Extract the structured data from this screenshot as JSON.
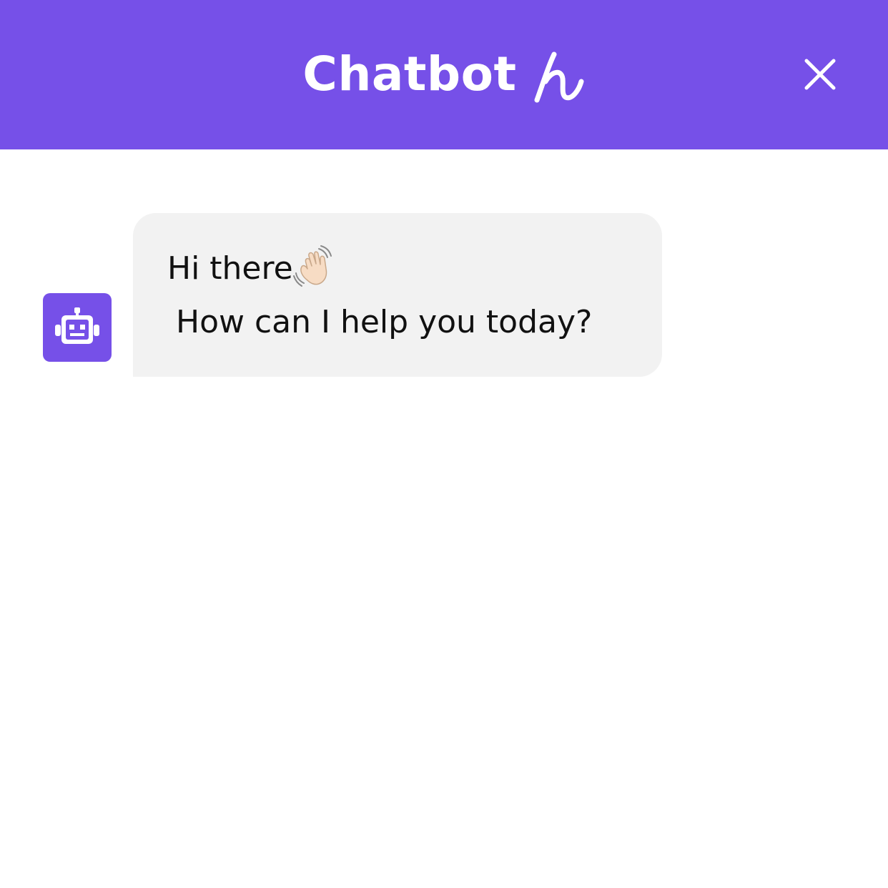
{
  "header": {
    "title": "Chatbot",
    "brand_icon": "handwritten-h-logo",
    "background_color": "#7650E8",
    "close_icon": "close-icon"
  },
  "conversation": {
    "bot_avatar_icon": "robot-icon",
    "messages": [
      {
        "sender": "bot",
        "line1": "Hi there",
        "line1_emoji": "waving-hand",
        "line2": "How can I help you today?"
      }
    ]
  },
  "colors": {
    "accent": "#7650E8",
    "bubble_background": "#F2F2F2",
    "text": "#111111",
    "page_background": "#FFFFFF"
  }
}
